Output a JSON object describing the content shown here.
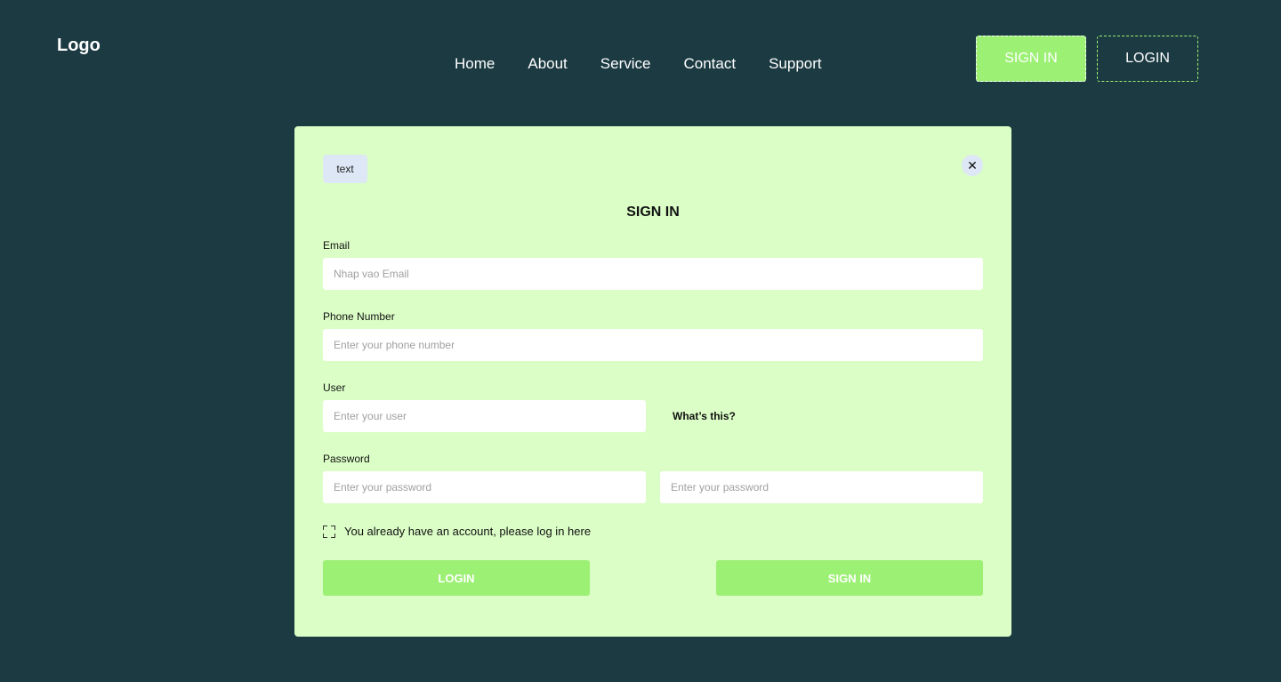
{
  "header": {
    "logo": "Logo",
    "nav": [
      "Home",
      "About",
      "Service",
      "Contact",
      "Support"
    ],
    "signin_label": "SIGN IN",
    "login_label": "LOGIN"
  },
  "modal": {
    "tag": "text",
    "close_symbol": "✕",
    "title": "SIGN IN",
    "email": {
      "label": "Email",
      "placeholder": "Nhap vao Email",
      "value": ""
    },
    "phone": {
      "label": "Phone Number",
      "placeholder": "Enter your phone number",
      "value": ""
    },
    "user": {
      "label": "User",
      "placeholder": "Enter your user",
      "value": "",
      "help": "What’s this?"
    },
    "password": {
      "label": "Password",
      "placeholder": "Enter your password",
      "confirm_placeholder": "Enter your password"
    },
    "checkbox_label": "You already have an account, please log in here",
    "login_button": "LOGIN",
    "signin_button": "SIGN IN"
  },
  "colors": {
    "background": "#1b3a42",
    "modal": "#dbfec6",
    "accent": "#9cf074"
  }
}
